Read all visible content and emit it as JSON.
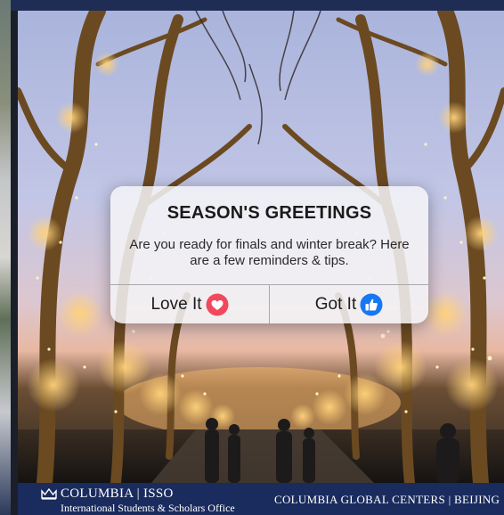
{
  "dialog": {
    "title": "SEASON'S GREETINGS",
    "message": "Are you ready for finals and winter break? Here are a few reminders & tips.",
    "love_label": "Love It",
    "got_label": "Got It",
    "love_icon": "heart-reaction-icon",
    "got_icon": "thumbs-up-reaction-icon",
    "love_color": "#f0495e",
    "got_color": "#1877f2"
  },
  "footer": {
    "brand": "COLUMBIA | ISSO",
    "brand_sub": "International Students & Scholars Office",
    "right_text": "COLUMBIA GLOBAL CENTERS | BEIJING",
    "logo_icon": "crown-icon",
    "background": "#1a2b5e"
  },
  "photo": {
    "subject": "illuminated-tree-lined-walkway"
  }
}
